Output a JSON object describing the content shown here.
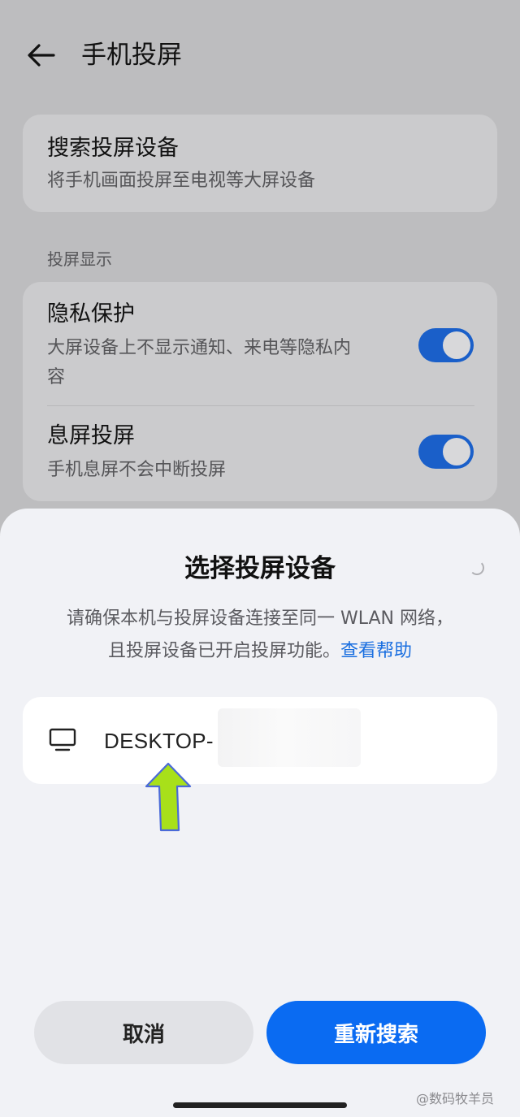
{
  "header": {
    "title": "手机投屏"
  },
  "search_card": {
    "title": "搜索投屏设备",
    "subtitle": "将手机画面投屏至电视等大屏设备"
  },
  "display_section": {
    "label": "投屏显示",
    "items": [
      {
        "title": "隐私保护",
        "subtitle_line1": "大屏设备上不显示通知、来电等隐私内",
        "subtitle_line2": "容",
        "enabled": true
      },
      {
        "title": "息屏投屏",
        "subtitle": "手机息屏不会中断投屏",
        "enabled": true
      }
    ]
  },
  "sheet": {
    "title": "选择投屏设备",
    "desc_line1": "请确保本机与投屏设备连接至同一 WLAN 网络，",
    "desc_line2": "且投屏设备已开启投屏功能。",
    "help_link": "查看帮助",
    "devices": [
      {
        "name": "DESKTOP-",
        "icon": "monitor-icon"
      }
    ],
    "cancel_label": "取消",
    "research_label": "重新搜索"
  },
  "watermark": "@数码牧羊员",
  "colors": {
    "accent": "#0a6bf2",
    "toggle_on": "#1a5fc9",
    "link": "#1a6fe0",
    "annotation_arrow": "#a8e01a"
  }
}
